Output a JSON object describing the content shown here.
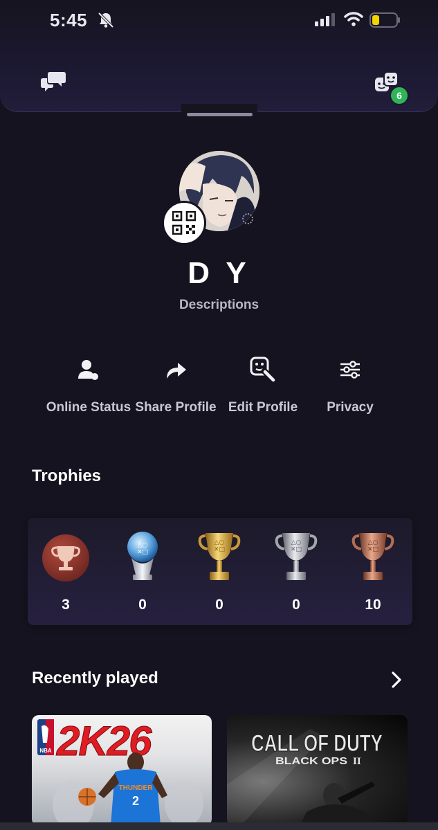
{
  "status_bar": {
    "time": "5:45",
    "battery_color": "#f2d400"
  },
  "top_bar": {
    "chat_icon": "chat-bubbles-icon",
    "friends_icon": "friends-icon",
    "friends_badge": "6",
    "badge_color": "#2fb457"
  },
  "profile": {
    "name": "D Y",
    "description": "Descriptions",
    "avatar": "anime-avatar",
    "qr_icon": "qr-code-icon"
  },
  "actions": [
    {
      "label": "Online Status",
      "icon": "person-status-icon"
    },
    {
      "label": "Share Profile",
      "icon": "share-arrow-icon"
    },
    {
      "label": "Edit Profile",
      "icon": "edit-face-icon"
    },
    {
      "label": "Privacy",
      "icon": "sliders-icon"
    }
  ],
  "trophies": {
    "title": "Trophies",
    "items": [
      {
        "kind": "level",
        "count": "3",
        "icon": "trophy-level-icon"
      },
      {
        "kind": "platinum",
        "count": "0",
        "icon": "platinum-trophy-icon"
      },
      {
        "kind": "gold",
        "count": "0",
        "icon": "gold-trophy-icon"
      },
      {
        "kind": "silver",
        "count": "0",
        "icon": "silver-trophy-icon"
      },
      {
        "kind": "bronze",
        "count": "10",
        "icon": "bronze-trophy-icon"
      }
    ]
  },
  "recently_played": {
    "title": "Recently played",
    "chevron": "chevron-right-icon",
    "games": [
      {
        "logo_text": "2K26",
        "league_text": "NBA",
        "jersey_text": "THUNDER",
        "number": "2"
      },
      {
        "logo_line1": "CALL OF DUTY",
        "logo_line2": "BLACK OPS",
        "logo_roman": "II"
      }
    ]
  },
  "colors": {
    "background": "#15131f",
    "text_secondary": "#c9c7d3"
  }
}
